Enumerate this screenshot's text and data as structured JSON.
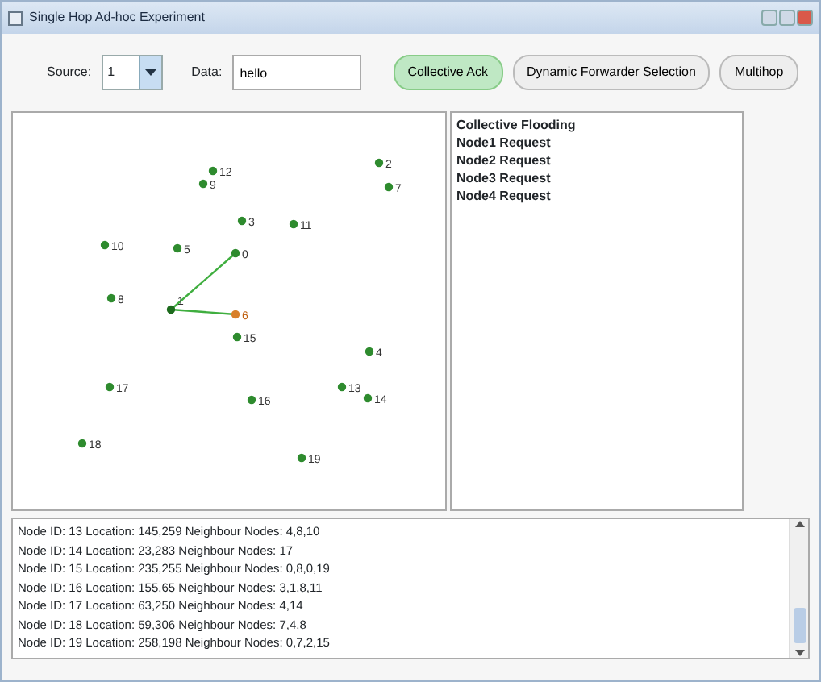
{
  "window": {
    "title": "Single Hop Ad-hoc Experiment"
  },
  "toolbar": {
    "source_label": "Source:",
    "source_value": "1",
    "data_label": "Data:",
    "data_value": "hello",
    "buttons": [
      {
        "label": "Collective Ack",
        "selected": true
      },
      {
        "label": "Dynamic Forwarder Selection",
        "selected": false
      },
      {
        "label": "Multihop",
        "selected": false
      }
    ]
  },
  "nodes": [
    {
      "label": "12",
      "kind": "node",
      "connected": false,
      "selected": false
    },
    {
      "label": "9",
      "kind": "node",
      "connected": false,
      "selected": false
    },
    {
      "label": "2",
      "kind": "node",
      "connected": false,
      "selected": false
    },
    {
      "label": "7",
      "kind": "node",
      "connected": false,
      "selected": false
    },
    {
      "label": "3",
      "kind": "node",
      "connected": false,
      "selected": false
    },
    {
      "label": "11",
      "kind": "node",
      "connected": false,
      "selected": false
    },
    {
      "label": "10",
      "kind": "node",
      "connected": false,
      "selected": false
    },
    {
      "label": "5",
      "kind": "node",
      "connected": false,
      "selected": false
    },
    {
      "label": "0",
      "kind": "node",
      "connected": true,
      "selected": false
    },
    {
      "label": "8",
      "kind": "node",
      "connected": false,
      "selected": false
    },
    {
      "label": "1",
      "kind": "source",
      "connected": false,
      "selected": false
    },
    {
      "label": "6",
      "kind": "node",
      "connected": true,
      "selected": true
    },
    {
      "label": "15",
      "kind": "node",
      "connected": false,
      "selected": false
    },
    {
      "label": "4",
      "kind": "node",
      "connected": false,
      "selected": false
    },
    {
      "label": "17",
      "kind": "node",
      "connected": false,
      "selected": false
    },
    {
      "label": "16",
      "kind": "node",
      "connected": false,
      "selected": false
    },
    {
      "label": "13",
      "kind": "node",
      "connected": false,
      "selected": false
    },
    {
      "label": "14",
      "kind": "node",
      "connected": false,
      "selected": false
    },
    {
      "label": "18",
      "kind": "node",
      "connected": false,
      "selected": false
    },
    {
      "label": "19",
      "kind": "node",
      "connected": false,
      "selected": false
    }
  ],
  "messages": [
    "Collective Flooding",
    "Node1 Request",
    "Node2 Request",
    "Node3 Request",
    "Node4 Request"
  ],
  "log": [
    "Node ID: 13  Location: 145,259  Neighbour Nodes: 4,8,10",
    "Node ID: 14  Location: 23,283  Neighbour Nodes: 17",
    "Node ID: 15  Location: 235,255  Neighbour Nodes: 0,8,0,19",
    "Node ID: 16  Location: 155,65  Neighbour Nodes: 3,1,8,11",
    "Node ID: 17  Location: 63,250  Neighbour Nodes: 4,14",
    "Node ID: 18  Location: 59,306  Neighbour Nodes: 7,4,8",
    "Node ID: 19  Location: 258,198  Neighbour Nodes: 0,7,2,15"
  ]
}
